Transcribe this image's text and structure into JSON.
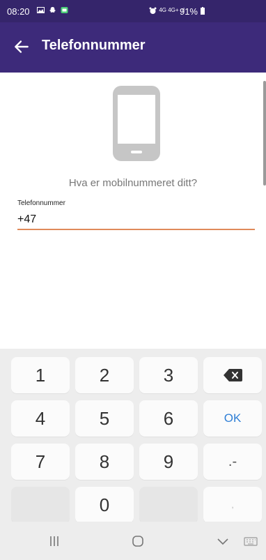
{
  "status_bar": {
    "time": "08:20",
    "battery_percent": "91%",
    "network_text": "4G 4G+ .ıl"
  },
  "app_bar": {
    "title": "Telefonnummer",
    "background": "#3d2a7a"
  },
  "main": {
    "question": "Hva er mobilnummeret ditt?",
    "field_label": "Telefonnummer",
    "field_value": "+47",
    "accent_color": "#e08a5a"
  },
  "keyboard": {
    "keys": {
      "k1": "1",
      "k2": "2",
      "k3": "3",
      "k4": "4",
      "k5": "5",
      "k6": "6",
      "k7": "7",
      "k8": "8",
      "k9": "9",
      "k0": "0",
      "ok": "OK",
      "dotdash": ".-",
      "comma": ","
    }
  },
  "nav_bar": {
    "icons": [
      "recent-apps-icon",
      "home-icon",
      "back-chevron-icon",
      "keyboard-icon"
    ]
  }
}
